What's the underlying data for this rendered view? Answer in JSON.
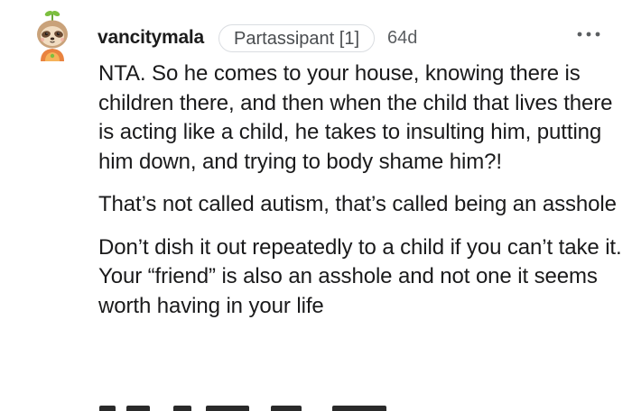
{
  "comment": {
    "username": "vancitymala",
    "flair": "Partassipant [1]",
    "age": "64d",
    "more_icon": "more-horizontal-icon",
    "avatar_icon": "sloth-avatar-icon",
    "paragraphs": [
      "NTA. So he comes to your house, knowing there is children there, and then when the child that lives there is acting like a child, he takes to insulting him, putting him down, and trying to body shame him?!",
      "That’s not called autism, that’s called being an asshole",
      "Don’t dish it out repeatedly to a child if you can’t take it. Your “friend” is also an asshole and not one it seems worth having in your life"
    ]
  },
  "colors": {
    "text": "#1a1a1b",
    "meta": "#5b5e61",
    "flair_border": "#dadde1",
    "background": "#ffffff"
  }
}
